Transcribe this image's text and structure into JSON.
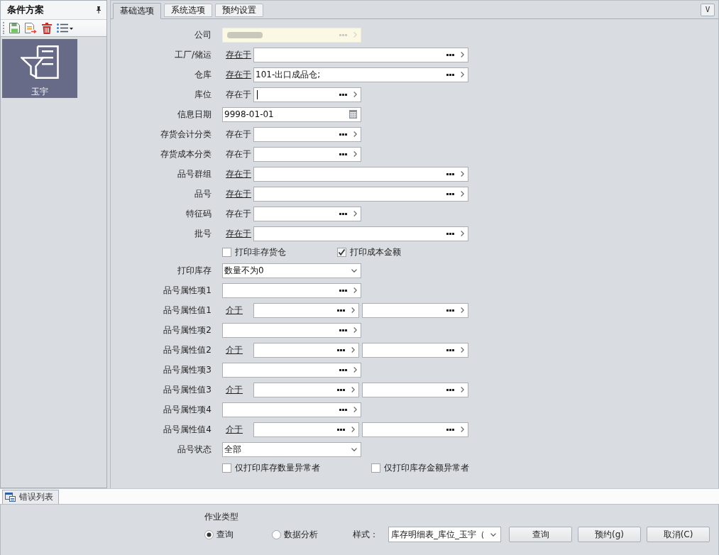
{
  "sidebar": {
    "title": "条件方案",
    "schemes": [
      {
        "label": "玉宇",
        "selected": true
      }
    ]
  },
  "tabs": [
    {
      "label": "基础选项",
      "selected": true
    },
    {
      "label": "系统选项",
      "selected": false
    },
    {
      "label": "预约设置",
      "selected": false
    }
  ],
  "collapse_button": {
    "label": "V"
  },
  "form": {
    "rows": [
      {
        "kind": "readonly",
        "label": "公司"
      },
      {
        "kind": "long-lookup",
        "label": "工厂/储运",
        "operator": {
          "text": "存在于",
          "link": true
        }
      },
      {
        "kind": "long-lookup",
        "label": "仓库",
        "operator": {
          "text": "存在于",
          "link": true
        },
        "value": "101-出口成品仓;"
      },
      {
        "kind": "short-lookup",
        "label": "库位",
        "operator": {
          "text": "存在于",
          "link": false
        },
        "focused": true
      },
      {
        "kind": "date",
        "label": "信息日期",
        "value": "9998-01-01"
      },
      {
        "kind": "short-lookup",
        "label": "存货会计分类",
        "operator": {
          "text": "存在于",
          "link": false
        }
      },
      {
        "kind": "short-lookup",
        "label": "存货成本分类",
        "operator": {
          "text": "存在于",
          "link": false
        }
      },
      {
        "kind": "long-lookup",
        "label": "品号群组",
        "operator": {
          "text": "存在于",
          "link": true
        }
      },
      {
        "kind": "long-lookup",
        "label": "品号",
        "operator": {
          "text": "存在于",
          "link": true
        }
      },
      {
        "kind": "short-lookup",
        "label": "特征码",
        "operator": {
          "text": "存在于",
          "link": false
        }
      },
      {
        "kind": "long-lookup",
        "label": "批号",
        "operator": {
          "text": "存在于",
          "link": true
        }
      },
      {
        "kind": "checks",
        "items": [
          {
            "label": "打印非存货仓",
            "checked": false
          },
          {
            "label": "打印成本金额",
            "checked": true
          }
        ]
      },
      {
        "kind": "select",
        "label": "打印库存",
        "value": "数量不为0"
      },
      {
        "kind": "plain-lookup",
        "label": "品号属性项1"
      },
      {
        "kind": "range",
        "label": "品号属性值1",
        "operator": {
          "text": "介于",
          "link": true
        }
      },
      {
        "kind": "plain-lookup",
        "label": "品号属性项2"
      },
      {
        "kind": "range",
        "label": "品号属性值2",
        "operator": {
          "text": "介于",
          "link": true
        }
      },
      {
        "kind": "plain-lookup",
        "label": "品号属性项3"
      },
      {
        "kind": "range",
        "label": "品号属性值3",
        "operator": {
          "text": "介于",
          "link": true
        }
      },
      {
        "kind": "plain-lookup",
        "label": "品号属性项4"
      },
      {
        "kind": "range",
        "label": "品号属性值4",
        "operator": {
          "text": "介于",
          "link": true
        }
      },
      {
        "kind": "select",
        "label": "品号状态",
        "value": "全部"
      },
      {
        "kind": "checks",
        "items": [
          {
            "label": "仅打印库存数量异常者",
            "checked": false
          },
          {
            "label": "仅打印库存金额异常者",
            "checked": false
          }
        ]
      }
    ]
  },
  "error_list_tab": {
    "label": "错误列表"
  },
  "job_type": {
    "title": "作业类型",
    "options": [
      {
        "label": "查询",
        "selected": true
      },
      {
        "label": "数据分析",
        "selected": false
      }
    ]
  },
  "style_select": {
    "label": "样式：",
    "value": "库存明细表_库位_玉宇（"
  },
  "buttons": [
    {
      "label": "查询"
    },
    {
      "label": "预约(g)"
    },
    {
      "label": "取消(C)"
    }
  ]
}
